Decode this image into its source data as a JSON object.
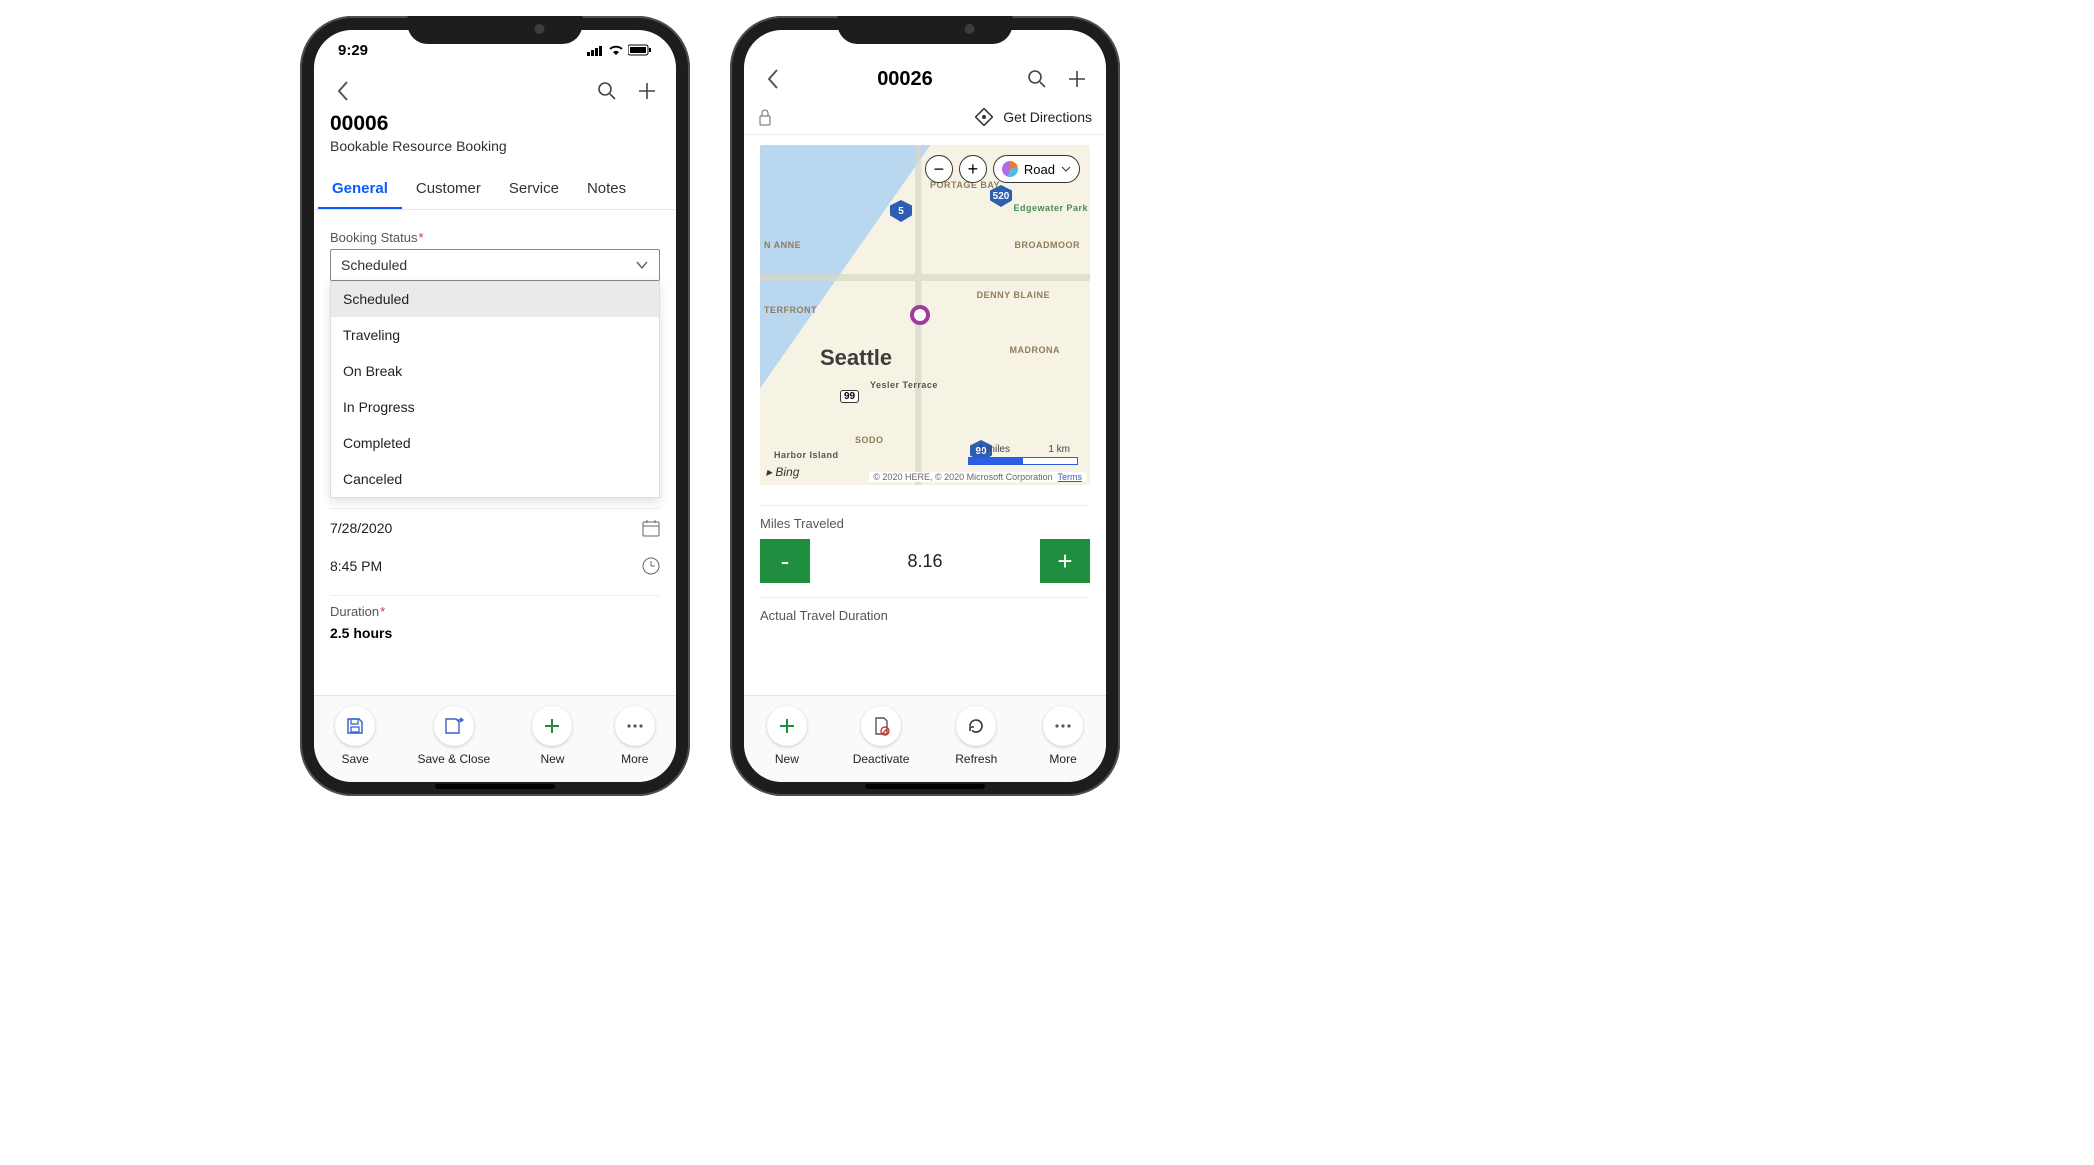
{
  "phone1": {
    "status": {
      "time": "9:29"
    },
    "title": "00006",
    "subtitle": "Bookable Resource Booking",
    "tabs": [
      "General",
      "Customer",
      "Service",
      "Notes"
    ],
    "active_tab": "General",
    "booking_status": {
      "label": "Booking Status",
      "required": true,
      "value": "Scheduled",
      "options": [
        "Scheduled",
        "Traveling",
        "On Break",
        "In Progress",
        "Completed",
        "Canceled"
      ]
    },
    "date": "7/28/2020",
    "time": "8:45 PM",
    "duration": {
      "label": "Duration",
      "required": true,
      "value": "2.5 hours"
    },
    "toolbar": [
      "Save",
      "Save & Close",
      "New",
      "More"
    ]
  },
  "phone2": {
    "title": "00026",
    "get_directions_label": "Get Directions",
    "map": {
      "zoom_out": "−",
      "zoom_in": "+",
      "layer": "Road",
      "city": "Seattle",
      "neighborhoods": {
        "portage": "PORTAGE BAY",
        "broadmoor": "BROADMOOR",
        "denny": "DENNY BLAINE",
        "madrona": "MADRONA",
        "nann": "N ANNE",
        "terfront": "TERFRONT",
        "yesler": "Yesler Terrace",
        "sodo": "SODO",
        "harbor": "Harbor Island",
        "edgewater": "Edgewater Park"
      },
      "shields": {
        "i5": "5",
        "i520": "520",
        "i90": "90",
        "r99": "99"
      },
      "provider": "Bing",
      "attribution_copy": "© 2020 HERE, © 2020 Microsoft Corporation",
      "attribution_terms": "Terms",
      "scale_mi": "1 miles",
      "scale_km": "1 km"
    },
    "miles": {
      "label": "Miles Traveled",
      "value": "8.16",
      "minus": "-",
      "plus": "+"
    },
    "actual_travel_label": "Actual Travel Duration",
    "toolbar": [
      "New",
      "Deactivate",
      "Refresh",
      "More"
    ]
  }
}
